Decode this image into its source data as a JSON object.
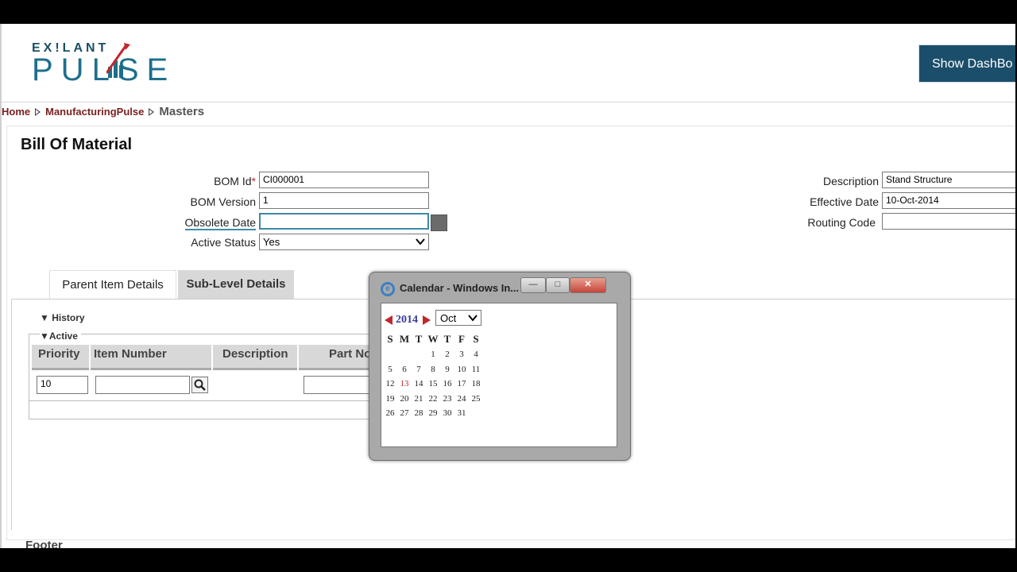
{
  "app": {
    "logo_top": "EX!LANT",
    "logo_main": "PULSE",
    "dashboard_button": "Show DashBo",
    "brand_color": "#1b4e6a"
  },
  "breadcrumb": {
    "items": [
      "Home",
      "ManufacturingPulse"
    ],
    "current": "Masters"
  },
  "page": {
    "title": "Bill Of Material"
  },
  "form": {
    "bom_id_label": "BOM Id",
    "bom_id_required": "*",
    "bom_id_value": "CI000001",
    "bom_version_label": "BOM Version",
    "bom_version_value": "1",
    "obsolete_date_label": "Obsolete Date",
    "obsolete_date_value": "",
    "active_status_label": "Active Status",
    "active_status_value": "Yes",
    "description_label": "Description",
    "description_value": "Stand Structure",
    "effective_date_label": "Effective Date",
    "effective_date_value": "10-Oct-2014",
    "routing_code_label": "Routing Code",
    "routing_code_value": ""
  },
  "tabs": [
    {
      "label": "Parent Item Details",
      "active": true
    },
    {
      "label": "Sub-Level Details",
      "active": false
    }
  ],
  "panel": {
    "history_label": "History",
    "active_label": "Active",
    "columns": [
      "Priority",
      "Item Number",
      "Description",
      "Part No"
    ],
    "row": {
      "priority": "10",
      "item_number": "",
      "part_no": ""
    }
  },
  "popup": {
    "title": "Calendar - Windows In...",
    "year": "2014",
    "month": "Oct",
    "weekdays": [
      "S",
      "M",
      "T",
      "W",
      "T",
      "F",
      "S"
    ],
    "weeks": [
      [
        "",
        "",
        "",
        "1",
        "2",
        "3",
        "4"
      ],
      [
        "5",
        "6",
        "7",
        "8",
        "9",
        "10",
        "11"
      ],
      [
        "12",
        "13",
        "14",
        "15",
        "16",
        "17",
        "18"
      ],
      [
        "19",
        "20",
        "21",
        "22",
        "23",
        "24",
        "25"
      ],
      [
        "26",
        "27",
        "28",
        "29",
        "30",
        "31",
        ""
      ]
    ],
    "today": "13"
  },
  "footer": {
    "label": "Footer"
  }
}
